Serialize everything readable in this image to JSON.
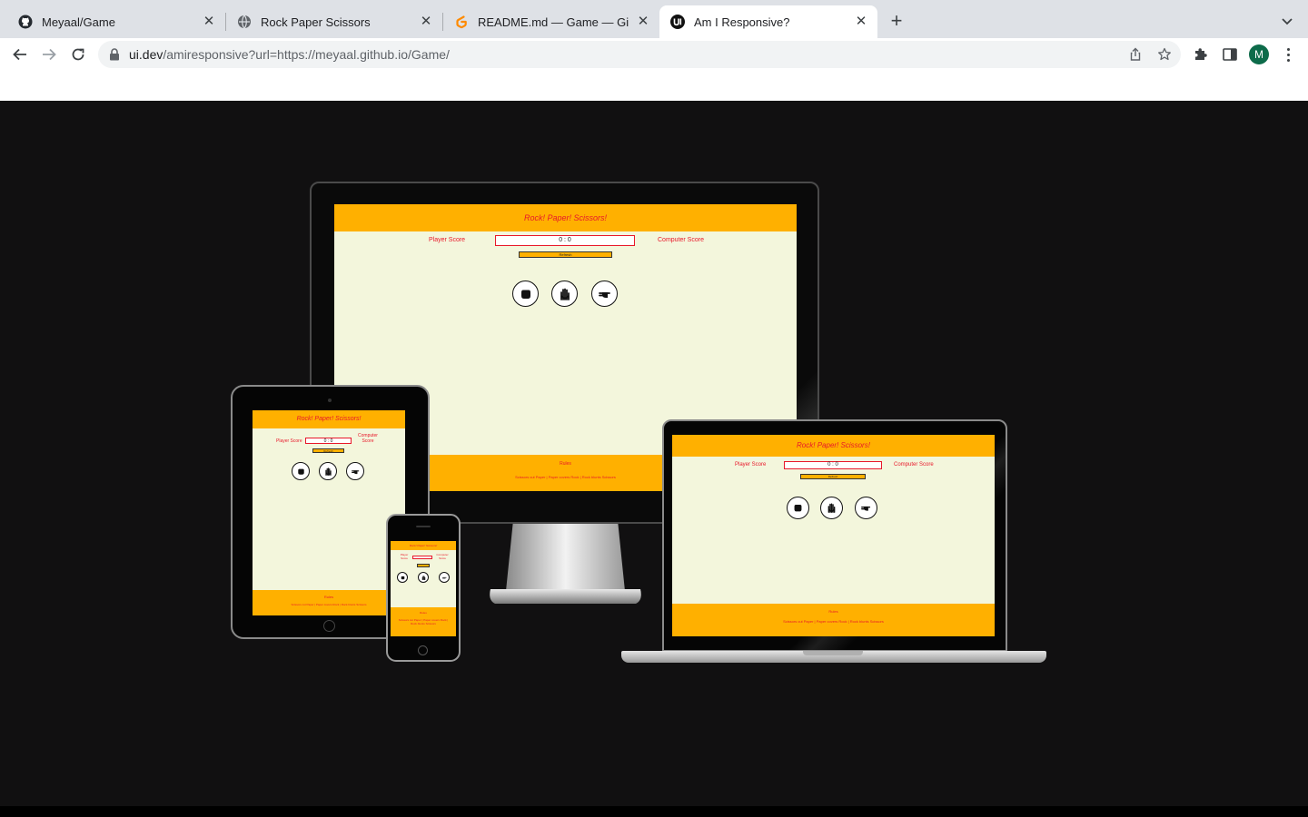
{
  "browser": {
    "tabs": [
      {
        "label": "Meyaal/Game",
        "icon": "github-icon"
      },
      {
        "label": "Rock Paper Scissors",
        "icon": "globe-icon"
      },
      {
        "label": "README.md — Game — Gitpod",
        "icon": "gitpod-icon"
      },
      {
        "label": "Am I Responsive?",
        "icon": "ui-dev-icon"
      }
    ],
    "url_host": "ui.dev",
    "url_path": "/amiresponsive?url=https://meyaal.github.io/Game/",
    "profile_initial": "M"
  },
  "game": {
    "title": "Rock!  Paper!  Scissors!",
    "player_label": "Player Score",
    "computer_label": "Computer Score",
    "score": "0 : 0",
    "refresh_label": "Refresh",
    "choices": [
      "rock-icon",
      "paper-icon",
      "scissors-icon"
    ],
    "rules_title": "Rules",
    "rules_text": "Scissors cut Paper | Paper covers Rock | Rock blunts Scissors"
  },
  "colors": {
    "accent": "#ffb000",
    "text_red": "#e8182a",
    "screen_bg": "#f3f6dc",
    "stage_bg": "#111011"
  }
}
